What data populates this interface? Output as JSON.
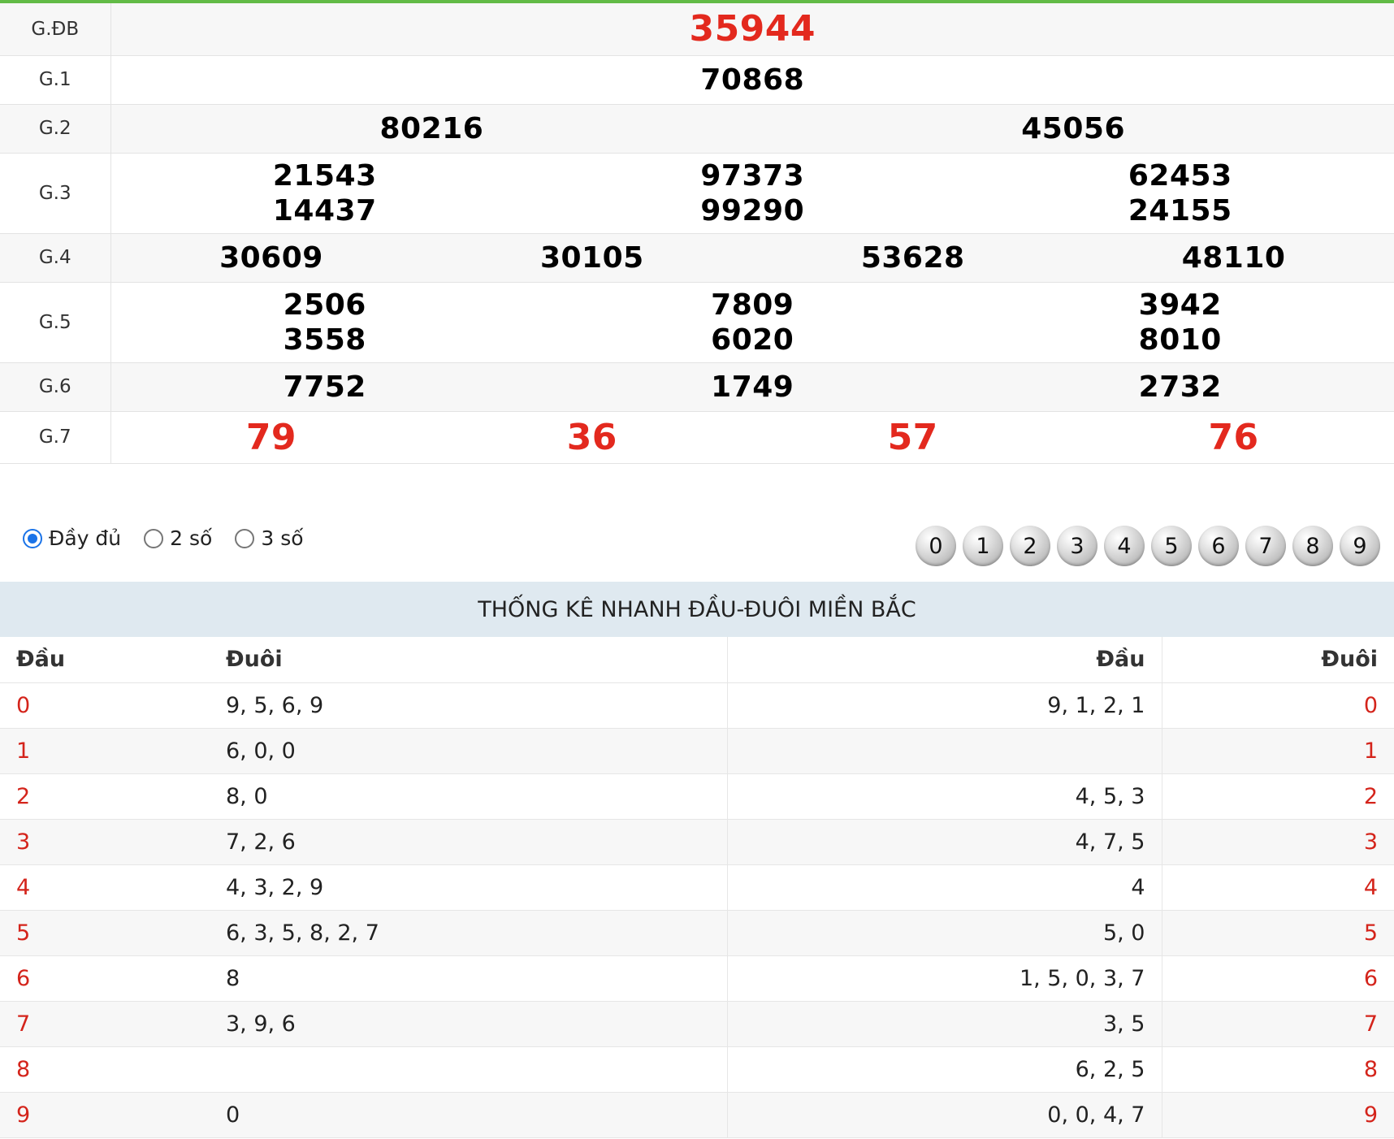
{
  "prizes": [
    {
      "label": "G.ĐB",
      "rows": [
        [
          "35944"
        ]
      ],
      "style": "special"
    },
    {
      "label": "G.1",
      "rows": [
        [
          "70868"
        ]
      ]
    },
    {
      "label": "G.2",
      "rows": [
        [
          "80216",
          "45056"
        ]
      ]
    },
    {
      "label": "G.3",
      "rows": [
        [
          "21543",
          "97373",
          "62453"
        ],
        [
          "14437",
          "99290",
          "24155"
        ]
      ]
    },
    {
      "label": "G.4",
      "rows": [
        [
          "30609",
          "30105",
          "53628",
          "48110"
        ]
      ]
    },
    {
      "label": "G.5",
      "rows": [
        [
          "2506",
          "7809",
          "3942"
        ],
        [
          "3558",
          "6020",
          "8010"
        ]
      ]
    },
    {
      "label": "G.6",
      "rows": [
        [
          "7752",
          "1749",
          "2732"
        ]
      ]
    },
    {
      "label": "G.7",
      "rows": [
        [
          "79",
          "36",
          "57",
          "76"
        ]
      ],
      "style": "red"
    }
  ],
  "view_options": [
    {
      "label": "Đầy đủ",
      "checked": true
    },
    {
      "label": "2 số",
      "checked": false
    },
    {
      "label": "3 số",
      "checked": false
    }
  ],
  "digit_balls": [
    "0",
    "1",
    "2",
    "3",
    "4",
    "5",
    "6",
    "7",
    "8",
    "9"
  ],
  "stats": {
    "title": "THỐNG KÊ NHANH ĐẦU-ĐUÔI MIỀN BẮC",
    "headers": [
      "Đầu",
      "Đuôi",
      "Đầu",
      "Đuôi"
    ],
    "rows": [
      {
        "head": "0",
        "tails": "9, 5, 6, 9",
        "heads": "9, 1, 2, 1",
        "tail": "0"
      },
      {
        "head": "1",
        "tails": "6, 0, 0",
        "heads": "",
        "tail": "1"
      },
      {
        "head": "2",
        "tails": "8, 0",
        "heads": "4, 5, 3",
        "tail": "2"
      },
      {
        "head": "3",
        "tails": "7, 2, 6",
        "heads": "4, 7, 5",
        "tail": "3"
      },
      {
        "head": "4",
        "tails": "4, 3, 2, 9",
        "heads": "4",
        "tail": "4"
      },
      {
        "head": "5",
        "tails": "6, 3, 5, 8, 2, 7",
        "heads": "5, 0",
        "tail": "5"
      },
      {
        "head": "6",
        "tails": "8",
        "heads": "1, 5, 0, 3, 7",
        "tail": "6"
      },
      {
        "head": "7",
        "tails": "3, 9, 6",
        "heads": "3, 5",
        "tail": "7"
      },
      {
        "head": "8",
        "tails": "",
        "heads": "6, 2, 5",
        "tail": "8"
      },
      {
        "head": "9",
        "tails": "0",
        "heads": "0, 0, 4, 7",
        "tail": "9"
      }
    ]
  },
  "colors": {
    "accent_green": "#62bb46",
    "number_red": "#e3291e",
    "stat_header_bg": "#dfe9f0",
    "radio_blue": "#1a73e8"
  }
}
